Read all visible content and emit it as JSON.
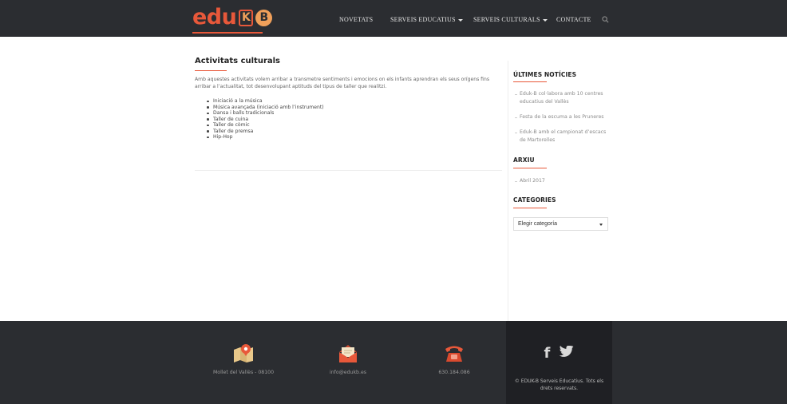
{
  "header": {
    "logo": {
      "text": "edu",
      "k": "K",
      "b": "B"
    },
    "nav": [
      {
        "label": "NOVETATS",
        "dropdown": false
      },
      {
        "label": "SERVEIS EDUCATIUS",
        "dropdown": true
      },
      {
        "label": "SERVEIS CULTURALS",
        "dropdown": true
      },
      {
        "label": "CONTACTE",
        "dropdown": false
      }
    ],
    "search_icon": "search-icon"
  },
  "main": {
    "title": "Activitats culturals",
    "intro": "Amb aquestes activitats volem arribar a transmetre sentiments i emocions on els infants aprendran els seus orígens fins arribar a l’actualitat, tot desenvolupant aptituds del tipus de taller que realitzi.",
    "activities": [
      "Iniciació a la música",
      "Música avançada (iniciació amb l’instrument)",
      "Dansa i balls tradicionals",
      "Taller de cuina",
      "Taller de còmic",
      "Taller de premsa",
      "Hip-Hop"
    ]
  },
  "sidebar": {
    "news_heading": "ÚLTIMES NOTÍCIES",
    "news": [
      "Eduk-B col·labora amb 10 centres educatius del Vallès",
      "Festa de la escuma a les Pruneres",
      "Eduk-B amb el campionat d’escacs de Martorelles"
    ],
    "archive_heading": "ARXIU",
    "archive": [
      "Abril 2017"
    ],
    "categories_heading": "CATEGORIES",
    "categories_select": "Elegir categoría"
  },
  "footer": {
    "location": {
      "icon": "map-pin-icon",
      "label": "Mollet del Vallès - 08100"
    },
    "email": {
      "icon": "envelope-icon",
      "label": "info@edukb.es"
    },
    "phone": {
      "icon": "telephone-icon",
      "label": "630.184.086"
    },
    "social": {
      "facebook": "f",
      "twitter_icon": "twitter-icon"
    },
    "copyright": "© EDUK-B Serveis Educatius. Tots els drets reservats."
  },
  "colors": {
    "accent": "#e8583a",
    "header_bg": "#2b2d31",
    "footer_bg": "#2b2d31",
    "footer_side_bg": "#1f2024"
  }
}
